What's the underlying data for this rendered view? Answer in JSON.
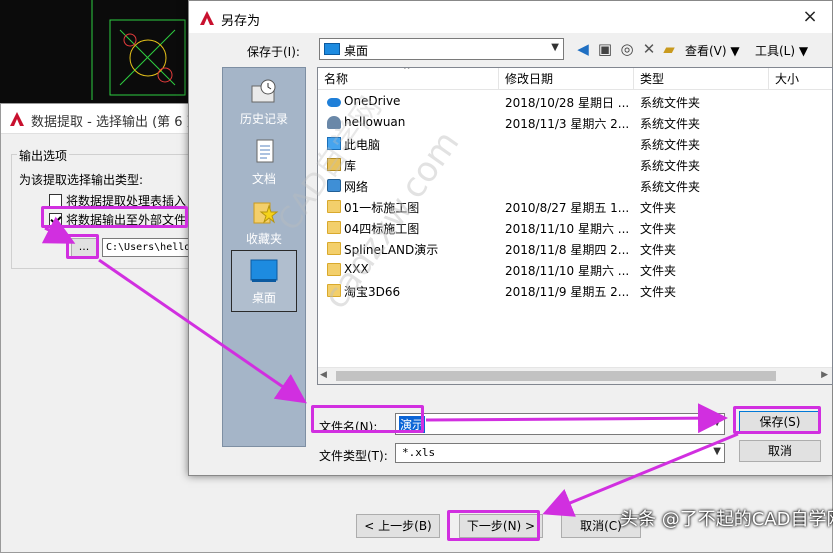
{
  "wizard": {
    "title": "数据提取 - 选择输出 (第 6 页,",
    "output_group": "输出选项",
    "prompt": "为该提取选择输出类型:",
    "checkbox_1": "将数据提取处理表插入",
    "checkbox_2": "将数据输出至外部文件",
    "checkbox_1_checked": false,
    "checkbox_2_checked": true,
    "browse_label": "...",
    "path_value": "C:\\Users\\hello",
    "back_label": "< 上一步(B)",
    "next_label": "下一步(N) >",
    "cancel_label": "取消(C)"
  },
  "saveas": {
    "title": "另存为",
    "close_label": "×",
    "savein_label": "保存于(I):",
    "savein_value": "桌面",
    "view_label": "查看(V)",
    "tools_label": "工具(L)",
    "places": [
      {
        "label": "历史记录"
      },
      {
        "label": "文档"
      },
      {
        "label": "收藏夹"
      },
      {
        "label": "桌面"
      }
    ],
    "columns": {
      "name": "名称",
      "date": "修改日期",
      "type": "类型",
      "size": "大小"
    },
    "files": [
      {
        "name": "OneDrive",
        "date": "2018/10/28 星期日 ...",
        "type": "系统文件夹",
        "icon": "cloud-icon"
      },
      {
        "name": "hellowuan",
        "date": "2018/11/3 星期六 2...",
        "type": "系统文件夹",
        "icon": "user-icon"
      },
      {
        "name": "此电脑",
        "date": "",
        "type": "系统文件夹",
        "icon": "computer-icon"
      },
      {
        "name": "库",
        "date": "",
        "type": "系统文件夹",
        "icon": "library-icon"
      },
      {
        "name": "网络",
        "date": "",
        "type": "系统文件夹",
        "icon": "network-icon"
      },
      {
        "name": "01一标施工图",
        "date": "2010/8/27 星期五 1...",
        "type": "文件夹",
        "icon": "folder-icon"
      },
      {
        "name": "04四标施工图",
        "date": "2018/11/10 星期六 ...",
        "type": "文件夹",
        "icon": "folder-icon"
      },
      {
        "name": "SplineLAND演示",
        "date": "2018/11/8 星期四 2...",
        "type": "文件夹",
        "icon": "folder-icon"
      },
      {
        "name": "XXX",
        "date": "2018/11/10 星期六 ...",
        "type": "文件夹",
        "icon": "folder-icon"
      },
      {
        "name": "淘宝3D66",
        "date": "2018/11/9 星期五 2...",
        "type": "文件夹",
        "icon": "folder-icon"
      }
    ],
    "filename_label": "文件名(N):",
    "filename_value": "演示",
    "filetype_label": "文件类型(T):",
    "filetype_value": "*.xls",
    "save_label": "保存(S)",
    "cancel_label": "取消"
  },
  "overlay": {
    "watermark_1": "cadzxw.com",
    "watermark_2": "CAD自学网",
    "toutiao": "头条 @了不起的CAD自学网",
    "annotation_color": "#d12fe0"
  }
}
